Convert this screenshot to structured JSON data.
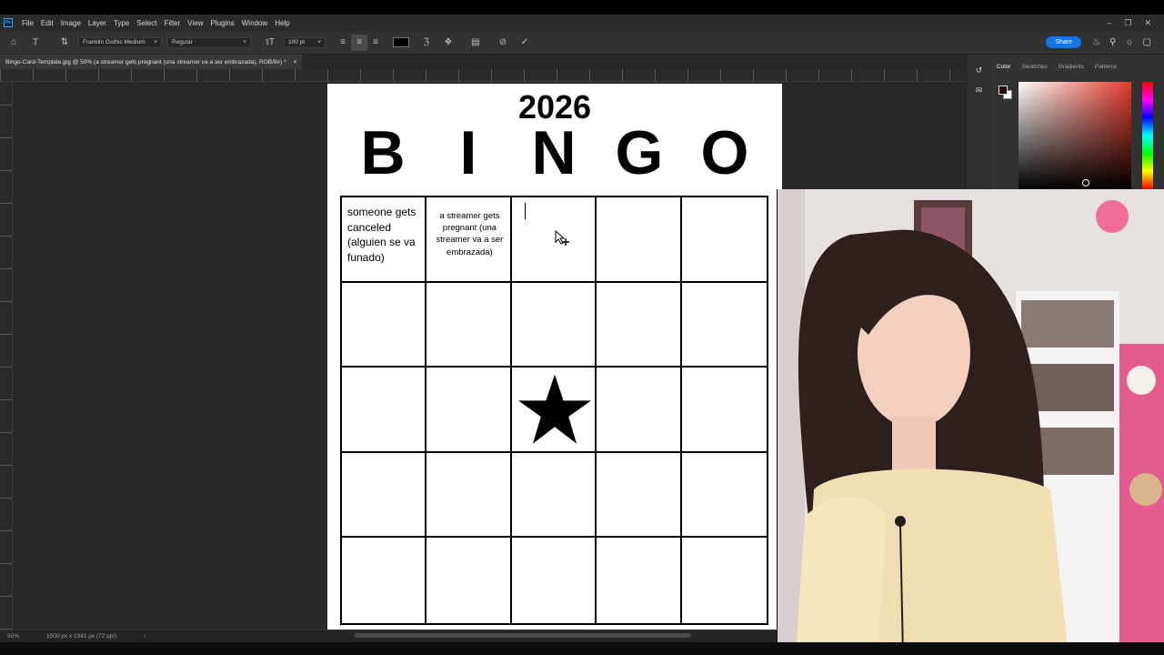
{
  "menubar": {
    "logo": "Ps",
    "items": [
      "File",
      "Edit",
      "Image",
      "Layer",
      "Type",
      "Select",
      "Filter",
      "View",
      "Plugins",
      "Window",
      "Help"
    ]
  },
  "options": {
    "font_family": "Franklin Gothic Medium",
    "font_style": "Regular",
    "font_size": "100 pt",
    "share_label": "Share",
    "text_color": "#000000"
  },
  "document": {
    "tab_title": "Bingo-Card-Template.jpg @ 50% (a streamer gets pregnant (una streamer va a ser embrazada), RGB/8#) *",
    "zoom": "50%",
    "doc_info": "1500 px x 1941 px (72 ppi)"
  },
  "panel": {
    "tabs": [
      "Color",
      "Swatches",
      "Gradients",
      "Patterns"
    ],
    "active_tab": "Color",
    "foreground_color": "#2a0b0b",
    "background_color": "#ffffff"
  },
  "bingo": {
    "year": "2026",
    "letters": [
      "B",
      "I",
      "N",
      "G",
      "O"
    ],
    "cell_1": "someone gets canceled (alguien se va funado)",
    "cell_2": "a streamer gets pregnant (una streamer va a ser embrazada)",
    "free_space_icon": "star-icon"
  },
  "webcam": {
    "description_icon": "webcam-feed"
  }
}
